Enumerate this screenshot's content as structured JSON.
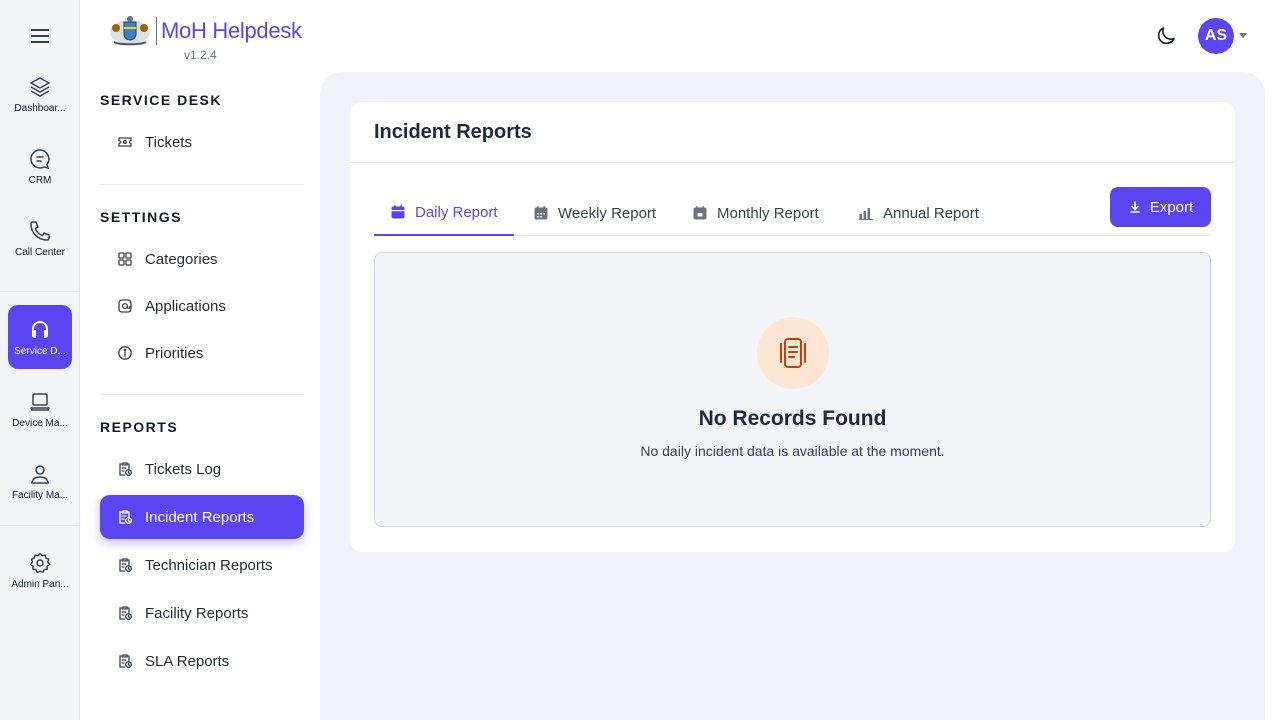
{
  "rail": {
    "items": [
      {
        "label": "Dashboar...",
        "icon": "layers-icon"
      },
      {
        "label": "CRM",
        "icon": "crm-chat-icon"
      },
      {
        "label": "Call Center",
        "icon": "phone-icon"
      },
      {
        "label": "Service D...",
        "icon": "headset-icon"
      },
      {
        "label": "Device Ma...",
        "icon": "laptop-icon"
      },
      {
        "label": "Facility Ma...",
        "icon": "user-icon"
      },
      {
        "label": "Admin Pan...",
        "icon": "gear-icon"
      }
    ]
  },
  "brand": {
    "name": "MoH Helpdesk",
    "version": "v1.2.4"
  },
  "sidebar": {
    "sections": [
      {
        "title": "SERVICE DESK",
        "items": [
          {
            "label": "Tickets"
          }
        ]
      },
      {
        "title": "SETTINGS",
        "items": [
          {
            "label": "Categories"
          },
          {
            "label": "Applications"
          },
          {
            "label": "Priorities"
          }
        ]
      },
      {
        "title": "REPORTS",
        "items": [
          {
            "label": "Tickets Log"
          },
          {
            "label": "Incident Reports"
          },
          {
            "label": "Technician Reports"
          },
          {
            "label": "Facility Reports"
          },
          {
            "label": "SLA Reports"
          }
        ]
      }
    ]
  },
  "user": {
    "initials": "AS"
  },
  "page": {
    "title": "Incident Reports",
    "tabs": [
      {
        "label": "Daily Report"
      },
      {
        "label": "Weekly Report"
      },
      {
        "label": "Monthly Report"
      },
      {
        "label": "Annual Report"
      }
    ],
    "export_label": "Export",
    "empty": {
      "title": "No Records Found",
      "message": "No daily incident data is available at the moment."
    }
  },
  "colors": {
    "accent": "#5b45f0",
    "empty_icon_bg": "#fde7d4",
    "empty_icon_fg": "#c2410c"
  }
}
